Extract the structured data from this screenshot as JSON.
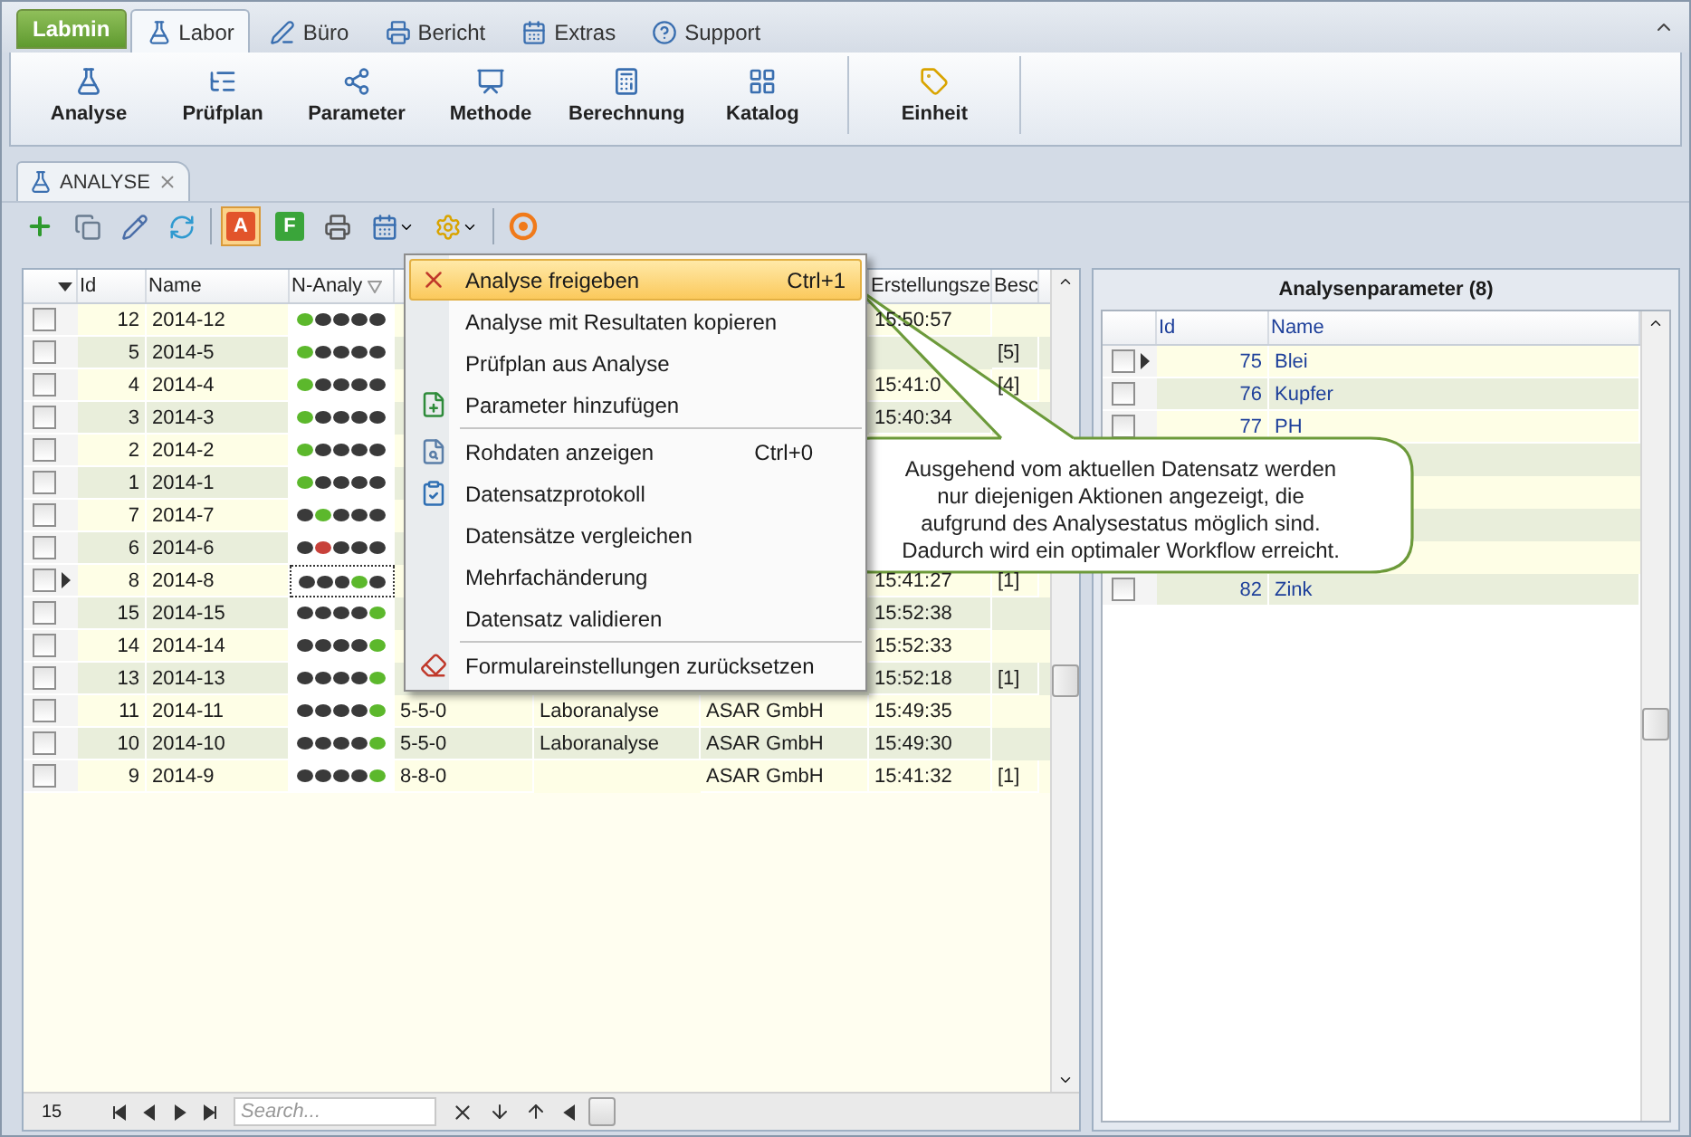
{
  "app_button": "Labmin",
  "ribbon_tabs": [
    {
      "label": "Labor",
      "selected": true
    },
    {
      "label": "Büro",
      "selected": false
    },
    {
      "label": "Bericht",
      "selected": false
    },
    {
      "label": "Extras",
      "selected": false
    },
    {
      "label": "Support",
      "selected": false
    }
  ],
  "ribbon_groups": [
    [
      "Analyse",
      "Prüfplan",
      "Parameter",
      "Methode",
      "Berechnung",
      "Katalog"
    ],
    [
      "Einheit"
    ]
  ],
  "document_tab": {
    "label": "ANALYSE"
  },
  "toolbar": {
    "letter_buttons": [
      {
        "label": "A",
        "selected": true
      },
      {
        "label": "F",
        "selected": false
      }
    ]
  },
  "grid": {
    "header": {
      "id": "Id",
      "name": "Name",
      "status": "N-Analy",
      "time": "Erstellungsze",
      "besc": "Besc"
    },
    "rows": [
      {
        "checked": false,
        "selected": false,
        "id": "12",
        "name": "2014-12",
        "dots": [
          {
            "color": "#5cb82c"
          },
          {
            "color": "#3a3a3a"
          },
          {
            "color": "#3a3a3a"
          },
          {
            "color": "#3a3a3a"
          },
          {
            "color": "#3a3a3a"
          }
        ],
        "time": "15:50:57"
      },
      {
        "checked": false,
        "selected": false,
        "id": "5",
        "name": "2014-5",
        "dots": [
          {
            "color": "#5cb82c"
          },
          {
            "color": "#3a3a3a"
          },
          {
            "color": "#3a3a3a"
          },
          {
            "color": "#3a3a3a"
          },
          {
            "color": "#3a3a3a"
          }
        ],
        "besc": "[5]"
      },
      {
        "checked": false,
        "selected": false,
        "id": "4",
        "name": "2014-4",
        "dots": [
          {
            "color": "#5cb82c"
          },
          {
            "color": "#3a3a3a"
          },
          {
            "color": "#3a3a3a"
          },
          {
            "color": "#3a3a3a"
          },
          {
            "color": "#3a3a3a"
          }
        ],
        "time": "15:41:0",
        "besc": "[4]"
      },
      {
        "checked": false,
        "selected": false,
        "id": "3",
        "name": "2014-3",
        "dots": [
          {
            "color": "#5cb82c"
          },
          {
            "color": "#3a3a3a"
          },
          {
            "color": "#3a3a3a"
          },
          {
            "color": "#3a3a3a"
          },
          {
            "color": "#3a3a3a"
          }
        ],
        "time": "15:40:34"
      },
      {
        "checked": false,
        "selected": false,
        "id": "2",
        "name": "2014-2",
        "dots": [
          {
            "color": "#5cb82c"
          },
          {
            "color": "#3a3a3a"
          },
          {
            "color": "#3a3a3a"
          },
          {
            "color": "#3a3a3a"
          },
          {
            "color": "#3a3a3a"
          }
        ]
      },
      {
        "checked": false,
        "selected": false,
        "id": "1",
        "name": "2014-1",
        "dots": [
          {
            "color": "#5cb82c"
          },
          {
            "color": "#3a3a3a"
          },
          {
            "color": "#3a3a3a"
          },
          {
            "color": "#3a3a3a"
          },
          {
            "color": "#3a3a3a"
          }
        ]
      },
      {
        "checked": false,
        "selected": false,
        "id": "7",
        "name": "2014-7",
        "dots": [
          {
            "color": "#3a3a3a"
          },
          {
            "color": "#5cb82c"
          },
          {
            "color": "#3a3a3a"
          },
          {
            "color": "#3a3a3a"
          },
          {
            "color": "#3a3a3a"
          }
        ]
      },
      {
        "checked": false,
        "selected": false,
        "id": "6",
        "name": "2014-6",
        "dots": [
          {
            "color": "#3a3a3a"
          },
          {
            "color": "#c8413a"
          },
          {
            "color": "#3a3a3a"
          },
          {
            "color": "#3a3a3a"
          },
          {
            "color": "#3a3a3a"
          }
        ]
      },
      {
        "checked": false,
        "selected": true,
        "id": "8",
        "name": "2014-8",
        "dots": [
          {
            "color": "#3a3a3a"
          },
          {
            "color": "#3a3a3a"
          },
          {
            "color": "#3a3a3a"
          },
          {
            "color": "#5cb82c"
          },
          {
            "color": "#3a3a3a"
          }
        ],
        "time": "15:41:27",
        "besc": "[1]"
      },
      {
        "checked": false,
        "selected": false,
        "id": "15",
        "name": "2014-15",
        "dots": [
          {
            "color": "#3a3a3a"
          },
          {
            "color": "#3a3a3a"
          },
          {
            "color": "#3a3a3a"
          },
          {
            "color": "#3a3a3a"
          },
          {
            "color": "#5cb82c"
          }
        ],
        "time": "15:52:38"
      },
      {
        "checked": false,
        "selected": false,
        "id": "14",
        "name": "2014-14",
        "dots": [
          {
            "color": "#3a3a3a"
          },
          {
            "color": "#3a3a3a"
          },
          {
            "color": "#3a3a3a"
          },
          {
            "color": "#3a3a3a"
          },
          {
            "color": "#5cb82c"
          }
        ],
        "time": "15:52:33"
      },
      {
        "checked": false,
        "selected": false,
        "id": "13",
        "name": "2014-13",
        "dots": [
          {
            "color": "#3a3a3a"
          },
          {
            "color": "#3a3a3a"
          },
          {
            "color": "#3a3a3a"
          },
          {
            "color": "#3a3a3a"
          },
          {
            "color": "#5cb82c"
          }
        ],
        "time": "15:52:18",
        "besc": "[1]"
      },
      {
        "checked": false,
        "selected": false,
        "id": "11",
        "name": "2014-11",
        "dots": [
          {
            "color": "#3a3a3a"
          },
          {
            "color": "#3a3a3a"
          },
          {
            "color": "#3a3a3a"
          },
          {
            "color": "#3a3a3a"
          },
          {
            "color": "#5cb82c"
          }
        ],
        "column_5": "5-5-0",
        "column_6": "Laboranalyse",
        "column_7": "ASAR GmbH",
        "time": "15:49:35"
      },
      {
        "checked": false,
        "selected": false,
        "id": "10",
        "name": "2014-10",
        "dots": [
          {
            "color": "#3a3a3a"
          },
          {
            "color": "#3a3a3a"
          },
          {
            "color": "#3a3a3a"
          },
          {
            "color": "#3a3a3a"
          },
          {
            "color": "#5cb82c"
          }
        ],
        "column_5": "5-5-0",
        "column_6": "Laboranalyse",
        "column_7": "ASAR GmbH",
        "time": "15:49:30"
      },
      {
        "checked": false,
        "selected": false,
        "id": "9",
        "name": "2014-9",
        "dots": [
          {
            "color": "#3a3a3a"
          },
          {
            "color": "#3a3a3a"
          },
          {
            "color": "#3a3a3a"
          },
          {
            "color": "#3a3a3a"
          },
          {
            "color": "#5cb82c"
          }
        ],
        "column_5": "8-8-0",
        "column_7": "ASAR GmbH",
        "time": "15:41:32",
        "besc": "[1]"
      }
    ]
  },
  "footer": {
    "count": "15",
    "search_placeholder": "Search..."
  },
  "context_menu": [
    {
      "kind": "item",
      "label": "Analyse freigeben",
      "shortcut": "Ctrl+1",
      "selected": true
    },
    {
      "kind": "item",
      "label": "Analyse mit Resultaten kopieren",
      "selected": false
    },
    {
      "kind": "item",
      "label": "Prüfplan aus Analyse",
      "selected": false
    },
    {
      "kind": "item",
      "label": "Parameter hinzufügen",
      "selected": false
    },
    {
      "kind": "separator"
    },
    {
      "kind": "item",
      "label": "Rohdaten anzeigen",
      "shortcut": "Ctrl+0",
      "selected": false
    },
    {
      "kind": "item",
      "label": "Datensatzprotokoll",
      "selected": false
    },
    {
      "kind": "item",
      "label": "Datensätze vergleichen",
      "selected": false
    },
    {
      "kind": "item",
      "label": "Mehrfachänderung",
      "selected": false
    },
    {
      "kind": "item",
      "label": "Datensatz validieren",
      "selected": false
    },
    {
      "kind": "separator"
    },
    {
      "kind": "item",
      "label": "Formulareinstellungen zurücksetzen",
      "selected": false
    }
  ],
  "callout": {
    "text": "Ausgehend vom aktuellen Datensatz werden\nnur diejenigen Aktionen angezeigt, die\naufgrund des Analysestatus möglich sind.\nDadurch wird ein optimaler Workflow erreicht."
  },
  "parameters": {
    "title": "Analysenparameter (8)",
    "header": {
      "id": "Id",
      "name": "Name"
    },
    "rows": [
      {
        "checked": false,
        "selected": true,
        "id": "75",
        "name": "Blei"
      },
      {
        "checked": false,
        "selected": false,
        "id": "76",
        "name": "Kupfer"
      },
      {
        "checked": false,
        "selected": false,
        "id": "77",
        "name": "PH"
      },
      {},
      {},
      {},
      {},
      {
        "checked": false,
        "selected": false,
        "id": "82",
        "name": "Zink"
      }
    ]
  }
}
